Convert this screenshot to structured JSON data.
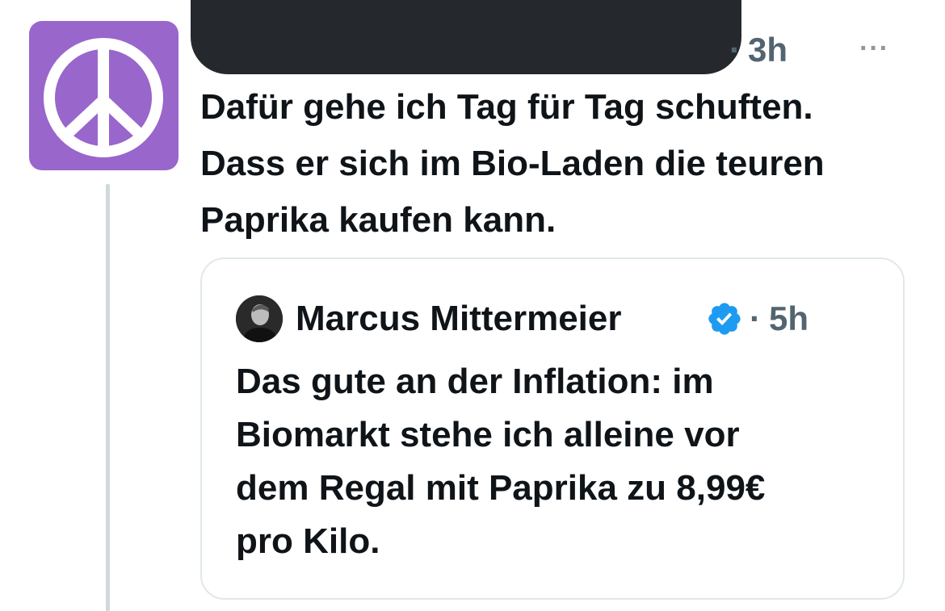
{
  "tweet": {
    "avatar_icon": "peace-symbol-icon",
    "avatar_color": "#9966cc",
    "time_separator": "·",
    "time": "3h",
    "more_label": "···",
    "text_lines": [
      "Dafür gehe ich Tag für Tag schuften.",
      "Dass er sich im Bio-Laden die teuren",
      "Paprika kaufen kann."
    ]
  },
  "quote": {
    "author_name": "Marcus Mittermeier",
    "verified_icon": "verified-badge-icon",
    "verified_color": "#1d9bf0",
    "separator": "·",
    "time": "5h",
    "text_lines": [
      "Das gute an der Inflation: im",
      "Biomarkt stehe ich alleine vor",
      "dem Regal mit Paprika zu 8,99€",
      "pro Kilo."
    ]
  }
}
